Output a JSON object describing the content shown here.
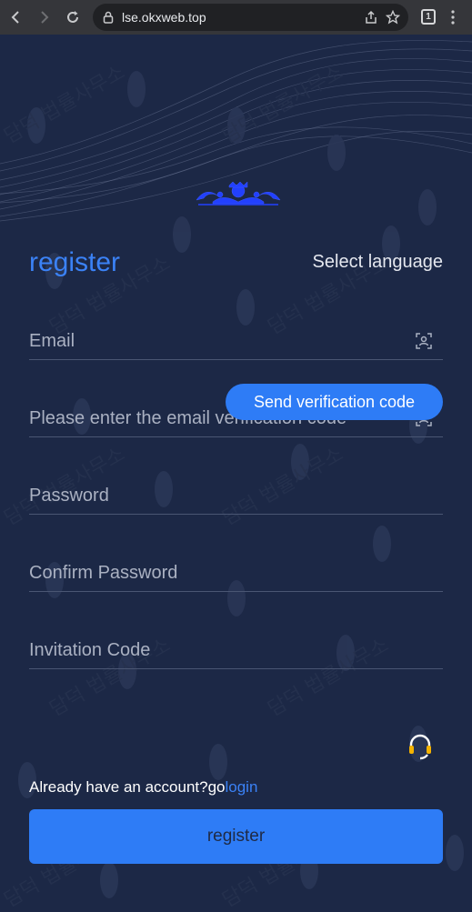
{
  "browser": {
    "url": "lse.okxweb.top",
    "tab_count": "1"
  },
  "page": {
    "title": "register",
    "select_language": "Select language",
    "fields": {
      "email": {
        "placeholder": "Email"
      },
      "email_code": {
        "placeholder": "Please enter the email verification code"
      },
      "password": {
        "placeholder": "Password"
      },
      "confirm_password": {
        "placeholder": "Confirm Password"
      },
      "invitation_code": {
        "placeholder": "Invitation Code"
      }
    },
    "send_code_label": "Send verification code",
    "already_text": "Already have an account?go",
    "login_link": "login",
    "register_button": "register",
    "watermark_text": "담덕 법률사무소"
  },
  "colors": {
    "background": "#1c2846",
    "accent": "#2e7cf6",
    "title": "#3b82f6"
  },
  "icons": [
    "back-icon",
    "forward-icon",
    "reload-icon",
    "lock-icon",
    "share-icon",
    "bookmark-icon",
    "menu-icon",
    "scan-icon",
    "headset-icon"
  ]
}
